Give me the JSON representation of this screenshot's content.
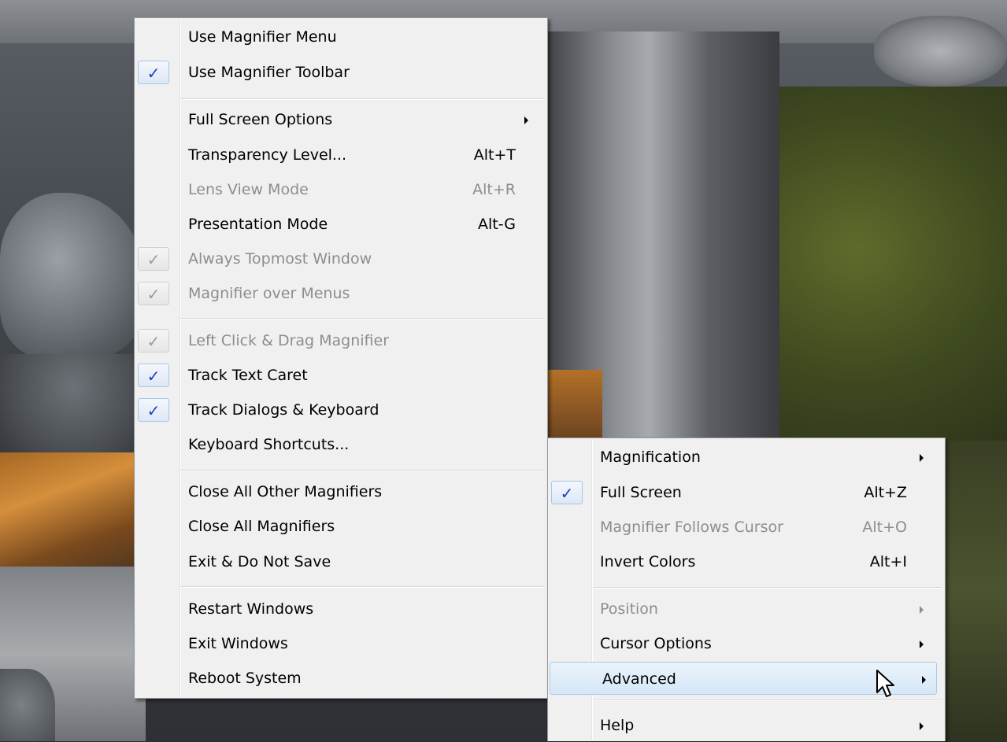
{
  "main_menu": {
    "items": [
      {
        "label": "Use Magnifier Menu",
        "checked": false,
        "disabled": false,
        "shortcut": "",
        "submenu": false
      },
      {
        "label": "Use Magnifier Toolbar",
        "checked": true,
        "disabled": false,
        "shortcut": "",
        "submenu": false
      },
      {
        "label": "Full Screen Options",
        "checked": false,
        "disabled": false,
        "shortcut": "",
        "submenu": true
      },
      {
        "label": "Transparency Level...",
        "checked": false,
        "disabled": false,
        "shortcut": "Alt+T",
        "submenu": false
      },
      {
        "label": "Lens View Mode",
        "checked": false,
        "disabled": true,
        "shortcut": "Alt+R",
        "submenu": false
      },
      {
        "label": "Presentation Mode",
        "checked": false,
        "disabled": false,
        "shortcut": "Alt-G",
        "submenu": false
      },
      {
        "label": "Always Topmost Window",
        "checked": true,
        "disabled": true,
        "shortcut": "",
        "submenu": false
      },
      {
        "label": "Magnifier over Menus",
        "checked": true,
        "disabled": true,
        "shortcut": "",
        "submenu": false
      },
      {
        "label": "Left Click & Drag Magnifier",
        "checked": true,
        "disabled": true,
        "shortcut": "",
        "submenu": false
      },
      {
        "label": "Track Text Caret",
        "checked": true,
        "disabled": false,
        "shortcut": "",
        "submenu": false
      },
      {
        "label": "Track Dialogs & Keyboard",
        "checked": true,
        "disabled": false,
        "shortcut": "",
        "submenu": false
      },
      {
        "label": "Keyboard Shortcuts...",
        "checked": false,
        "disabled": false,
        "shortcut": "",
        "submenu": false
      },
      {
        "label": "Close All Other Magnifiers",
        "checked": false,
        "disabled": false,
        "shortcut": "",
        "submenu": false
      },
      {
        "label": "Close All Magnifiers",
        "checked": false,
        "disabled": false,
        "shortcut": "",
        "submenu": false
      },
      {
        "label": "Exit & Do Not Save",
        "checked": false,
        "disabled": false,
        "shortcut": "",
        "submenu": false
      },
      {
        "label": "Restart Windows",
        "checked": false,
        "disabled": false,
        "shortcut": "",
        "submenu": false
      },
      {
        "label": "Exit Windows",
        "checked": false,
        "disabled": false,
        "shortcut": "",
        "submenu": false
      },
      {
        "label": "Reboot System",
        "checked": false,
        "disabled": false,
        "shortcut": "",
        "submenu": false
      }
    ]
  },
  "sub_menu": {
    "items": [
      {
        "label": "Magnification",
        "checked": false,
        "disabled": false,
        "shortcut": "",
        "submenu": true
      },
      {
        "label": "Full Screen",
        "checked": true,
        "disabled": false,
        "shortcut": "Alt+Z",
        "submenu": false
      },
      {
        "label": "Magnifier Follows Cursor",
        "checked": false,
        "disabled": true,
        "shortcut": "Alt+O",
        "submenu": false
      },
      {
        "label": "Invert Colors",
        "checked": false,
        "disabled": false,
        "shortcut": "Alt+I",
        "submenu": false
      },
      {
        "label": "Position",
        "checked": false,
        "disabled": true,
        "shortcut": "",
        "submenu": true
      },
      {
        "label": "Cursor Options",
        "checked": false,
        "disabled": false,
        "shortcut": "",
        "submenu": true
      },
      {
        "label": "Advanced",
        "checked": false,
        "disabled": false,
        "shortcut": "",
        "submenu": true,
        "highlighted": true
      },
      {
        "label": "Help",
        "checked": false,
        "disabled": false,
        "shortcut": "",
        "submenu": true
      }
    ]
  },
  "check_glyph": "✓",
  "icons": {
    "check": "checkmark-icon",
    "submenu_arrow": "chevron-right-icon",
    "cursor": "mouse-pointer-icon"
  }
}
